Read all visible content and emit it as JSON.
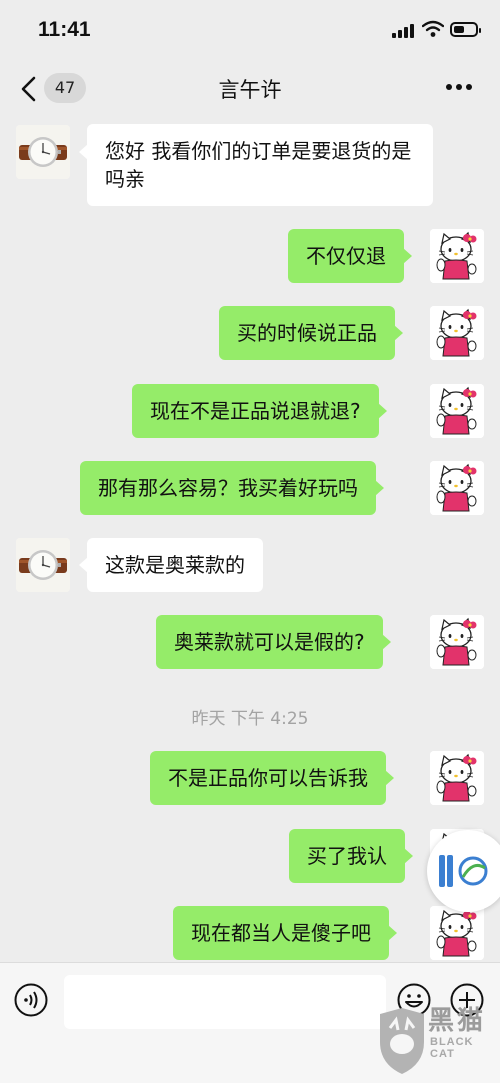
{
  "status": {
    "time": "11:41"
  },
  "header": {
    "unread_count": "47",
    "title": "言午许"
  },
  "messages": [
    {
      "side": "left",
      "text": "您好 我看你们的订单是要退货的是吗亲"
    },
    {
      "side": "right",
      "text": "不仅仅退"
    },
    {
      "side": "right",
      "text": "买的时候说正品"
    },
    {
      "side": "right",
      "text": "现在不是正品说退就退?"
    },
    {
      "side": "right",
      "text": "那有那么容易？我买着好玩吗"
    },
    {
      "side": "left",
      "text": "这款是奥莱款的"
    },
    {
      "side": "right",
      "text": "奥莱款就可以是假的?"
    },
    {
      "side": "right",
      "text": "不是正品你可以告诉我"
    },
    {
      "side": "right",
      "text": "买了我认"
    },
    {
      "side": "right",
      "text": "现在都当人是傻子吧"
    }
  ],
  "timestamp": "昨天 下午 4:25",
  "input": {
    "placeholder": ""
  },
  "watermark": {
    "text": "黑猫",
    "sub": "BLACK CAT"
  },
  "colors": {
    "bubble_self": "#95ec69",
    "bubble_other": "#ffffff",
    "background": "#ededed"
  },
  "icons": {
    "back": "chevron-left-icon",
    "more": "more-dots-icon",
    "voice": "voice-icon",
    "emoji": "emoji-icon",
    "plus": "plus-icon",
    "contact_avatar": "watch-avatar",
    "self_avatar": "hello-kitty-avatar"
  }
}
